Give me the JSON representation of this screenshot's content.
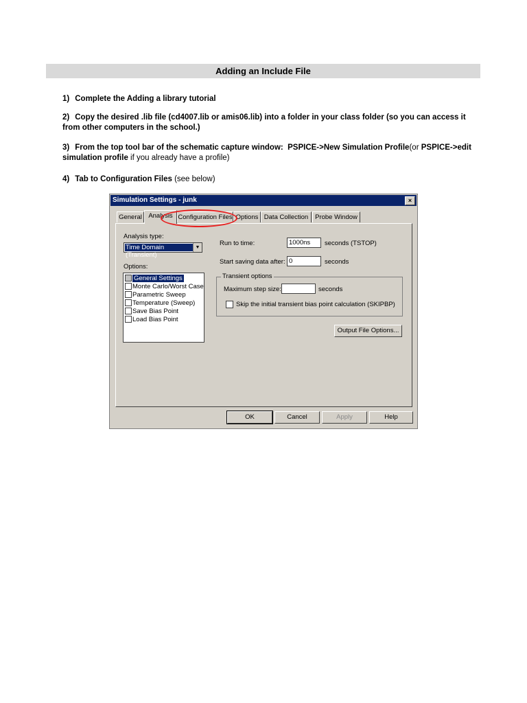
{
  "doc": {
    "title": "Adding an Include File",
    "steps": [
      {
        "num": "1)",
        "text": "Complete the Adding a library tutorial"
      },
      {
        "num": "2)",
        "text": "Copy the desired .lib file (cd4007.lib or amis06.lib) into a folder in your class folder (so you can access it from other computers in the school.)"
      },
      {
        "num": "3)",
        "pre": "From the top tool bar of the schematic capture window:",
        "b1": "PSPICE->New Simulation Profile",
        "mid": "(or",
        "b2": "PSPICE->edit simulation profile",
        "post": "if you already have a profile)"
      },
      {
        "num": "4)",
        "pre": "Tab to",
        "b1": "Configuration Files",
        "post": "(see below)"
      }
    ]
  },
  "dialog": {
    "title": "Simulation Settings - junk",
    "close": "×",
    "tabs": [
      "General",
      "Analysis",
      "Configuration Files",
      "Options",
      "Data Collection",
      "Probe Window"
    ],
    "analysis_type_label": "Analysis type:",
    "analysis_type_value": "Time Domain (Transient)",
    "options_label": "Options:",
    "options": [
      "General Settings",
      "Monte Carlo/Worst Case",
      "Parametric Sweep",
      "Temperature (Sweep)",
      "Save Bias Point",
      "Load Bias Point"
    ],
    "run_to_time_label": "Run to time:",
    "run_to_time_value": "1000ns",
    "run_to_time_unit": "seconds  (TSTOP)",
    "start_saving_label": "Start saving data after:",
    "start_saving_value": "0",
    "start_saving_unit": "seconds",
    "transient_group": "Transient options",
    "max_step_label": "Maximum step size:",
    "max_step_value": "",
    "max_step_unit": "seconds",
    "skip_label": "Skip the initial transient bias point calculation  (SKIPBP)",
    "output_file_button": "Output File Options...",
    "buttons": {
      "ok": "OK",
      "cancel": "Cancel",
      "apply": "Apply",
      "help": "Help"
    }
  },
  "colors": {
    "highlight": "#e81e1e",
    "title_bar": "#0a246a",
    "dialog_bg": "#d4d0c8"
  }
}
